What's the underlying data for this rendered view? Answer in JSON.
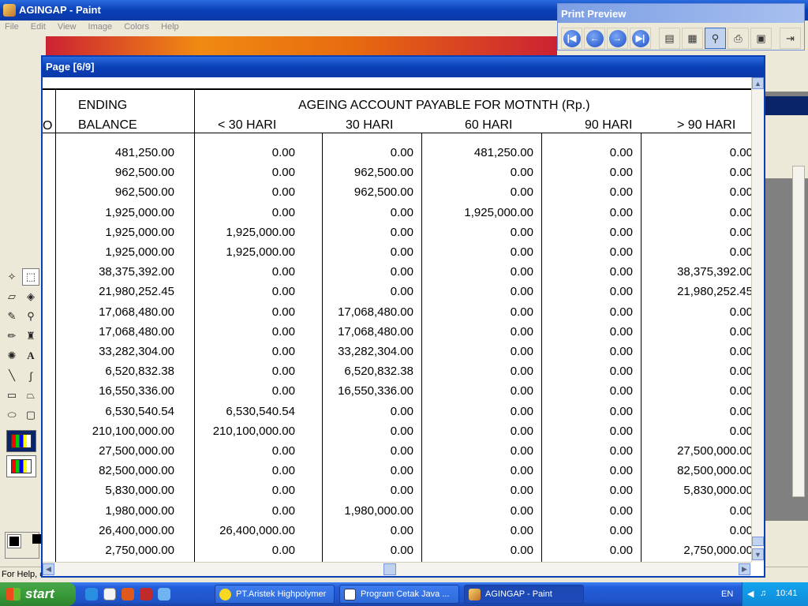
{
  "paint": {
    "title": "AGINGAP - Paint",
    "menu": [
      "File",
      "Edit",
      "View",
      "Image",
      "Colors",
      "Help"
    ],
    "status_text": "For Help, c"
  },
  "print_preview": {
    "title": "Print Preview",
    "buttons": [
      "first-page-icon",
      "prev-page-icon",
      "next-page-icon",
      "last-page-icon",
      "one-page-icon",
      "page-number-icon",
      "zoom-icon",
      "print-icon",
      "save-icon",
      "close-icon"
    ]
  },
  "page_window": {
    "title": "Page [6/9]"
  },
  "report": {
    "col0_header": [
      "",
      "O"
    ],
    "ending_header": [
      "ENDING",
      "BALANCE"
    ],
    "ageing_header": "AGEING ACCOUNT PAYABLE FOR MOTNTH (Rp.)",
    "buckets": [
      "< 30 HARI",
      "30 HARI",
      "60 HARI",
      "90 HARI",
      "> 90 HARI"
    ],
    "rows": [
      [
        "481,250.00",
        "0.00",
        "0.00",
        "481,250.00",
        "0.00",
        "0.00"
      ],
      [
        "962,500.00",
        "0.00",
        "962,500.00",
        "0.00",
        "0.00",
        "0.00"
      ],
      [
        "962,500.00",
        "0.00",
        "962,500.00",
        "0.00",
        "0.00",
        "0.00"
      ],
      [
        "1,925,000.00",
        "0.00",
        "0.00",
        "1,925,000.00",
        "0.00",
        "0.00"
      ],
      [
        "1,925,000.00",
        "1,925,000.00",
        "0.00",
        "0.00",
        "0.00",
        "0.00"
      ],
      [
        "1,925,000.00",
        "1,925,000.00",
        "0.00",
        "0.00",
        "0.00",
        "0.00"
      ],
      [
        "38,375,392.00",
        "0.00",
        "0.00",
        "0.00",
        "0.00",
        "38,375,392.00"
      ],
      [
        "21,980,252.45",
        "0.00",
        "0.00",
        "0.00",
        "0.00",
        "21,980,252.45"
      ],
      [
        "17,068,480.00",
        "0.00",
        "17,068,480.00",
        "0.00",
        "0.00",
        "0.00"
      ],
      [
        "17,068,480.00",
        "0.00",
        "17,068,480.00",
        "0.00",
        "0.00",
        "0.00"
      ],
      [
        "33,282,304.00",
        "0.00",
        "33,282,304.00",
        "0.00",
        "0.00",
        "0.00"
      ],
      [
        "6,520,832.38",
        "0.00",
        "6,520,832.38",
        "0.00",
        "0.00",
        "0.00"
      ],
      [
        "16,550,336.00",
        "0.00",
        "16,550,336.00",
        "0.00",
        "0.00",
        "0.00"
      ],
      [
        "6,530,540.54",
        "6,530,540.54",
        "0.00",
        "0.00",
        "0.00",
        "0.00"
      ],
      [
        "210,100,000.00",
        "210,100,000.00",
        "0.00",
        "0.00",
        "0.00",
        "0.00"
      ],
      [
        "27,500,000.00",
        "0.00",
        "0.00",
        "0.00",
        "0.00",
        "27,500,000.00"
      ],
      [
        "82,500,000.00",
        "0.00",
        "0.00",
        "0.00",
        "0.00",
        "82,500,000.00"
      ],
      [
        "5,830,000.00",
        "0.00",
        "0.00",
        "0.00",
        "0.00",
        "5,830,000.00"
      ],
      [
        "1,980,000.00",
        "0.00",
        "1,980,000.00",
        "0.00",
        "0.00",
        "0.00"
      ],
      [
        "26,400,000.00",
        "26,400,000.00",
        "0.00",
        "0.00",
        "0.00",
        "0.00"
      ],
      [
        "2,750,000.00",
        "0.00",
        "0.00",
        "0.00",
        "0.00",
        "2,750,000.00"
      ]
    ]
  },
  "taskbar": {
    "start_label": "start",
    "tasks": [
      {
        "label": "PT.Aristek Highpolymer",
        "icon": "smiley-icon"
      },
      {
        "label": "Program Cetak Java ...",
        "icon": "window-icon"
      },
      {
        "label": "AGINGAP - Paint",
        "icon": "paint-icon",
        "active": true
      }
    ],
    "language": "EN",
    "clock": "10:41"
  }
}
